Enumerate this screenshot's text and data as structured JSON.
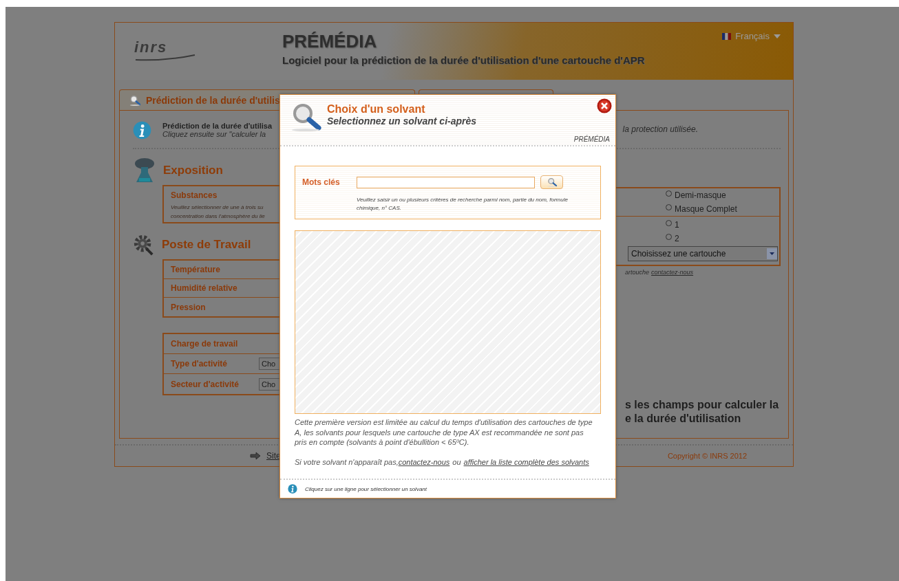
{
  "header": {
    "logo": "inrs",
    "title": "PRÉMÉDIA",
    "subtitle": "Logiciel pour la prédiction de la durée d'utilisation d'une cartouche d'APR",
    "language": "Français"
  },
  "tabs": [
    {
      "label": "Prédiction de la durée d'utilis",
      "selected": true
    },
    {
      "selected": false
    }
  ],
  "intro": {
    "line_1": "Prédiction de la durée d'utilisa",
    "line_2": "Cliquez ensuite sur \"calculer la",
    "line_3": "la protection utilisée."
  },
  "exposition": {
    "heading": "Exposition",
    "substances": {
      "label": "Substances",
      "description": [
        "Veuillez sélectionner de une à trois su",
        "concentration dans l'atmosphère du lie"
      ]
    }
  },
  "protection": {
    "mask_options": [
      {
        "label": "Demi-masque",
        "selected": false
      },
      {
        "label": "Masque Complet",
        "selected": false
      }
    ],
    "count_options": [
      {
        "label": "1",
        "selected": false
      },
      {
        "label": "2",
        "selected": false
      }
    ],
    "cartridge_select": "Choisissez une cartouche",
    "note": "artouche",
    "note_link": "contactez-nous"
  },
  "poste": {
    "heading": "Poste de Travail",
    "conditions": [
      "Température",
      "Humidité relative",
      "Pression"
    ],
    "workload": "Charge de travail",
    "activity_fields": [
      {
        "label": "Type d'activité",
        "value": "Cho"
      },
      {
        "label": "Secteur d'activité",
        "value": "Cho"
      }
    ]
  },
  "prompt": [
    "s les champs pour calculer la",
    "e la durée d'utilisation"
  ],
  "footer": {
    "site_link": "Site",
    "copyright": "Copyright © INRS 2012"
  },
  "dialog": {
    "title": "Choix d'un solvant",
    "subtitle": "Selectionnez un solvant ci-après",
    "brand": "PRÉMÉDIA",
    "search": {
      "label": "Mots clés",
      "hint": "Veuillez saisir un ou plusieurs critères de recherche parmi nom, partie du nom, formule chimique, n° CAS."
    },
    "note": "Cette première version est limitée au calcul du temps d'utilisation des cartouches de type A, les solvants pour lesquels une cartouche de type AX est recommandée ne sont pas pris en compte (solvants à point d'ébullition < 65ºC).",
    "missing_text": "Si votre solvant n'apparaît pas,",
    "contact_link": "contactez-nous",
    "or_text": "ou",
    "full_list_link": "afficher la liste complète des solvants",
    "footer_hint": "Cliquez sur une ligne pour sélectionner un solvant"
  }
}
